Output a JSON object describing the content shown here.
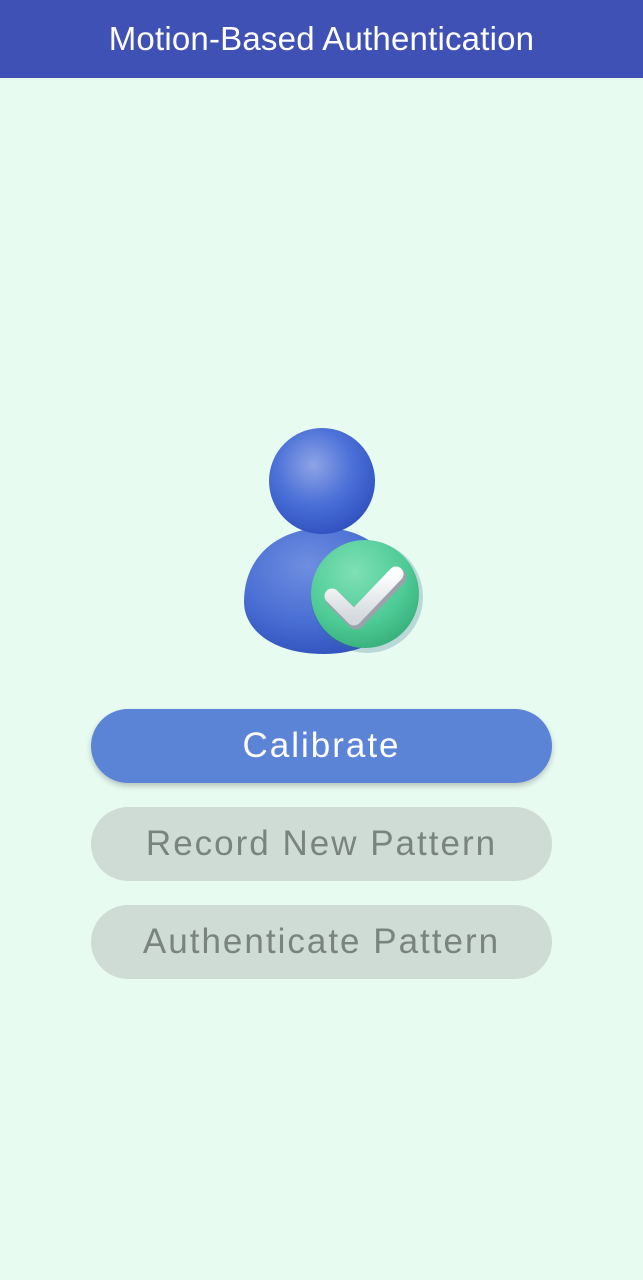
{
  "app_bar": {
    "title": "Motion-Based Authentication",
    "color": "#3f51b5"
  },
  "illustration": {
    "icon": "verified-user-icon"
  },
  "buttons": {
    "calibrate": {
      "label": "Calibrate",
      "enabled": true,
      "color": "#5b83d6"
    },
    "record": {
      "label": "Record New Pattern",
      "enabled": false,
      "color": "#cedcd5"
    },
    "authenticate": {
      "label": "Authenticate Pattern",
      "enabled": false,
      "color": "#cedcd5"
    }
  },
  "background_color": "#e8fbf1"
}
